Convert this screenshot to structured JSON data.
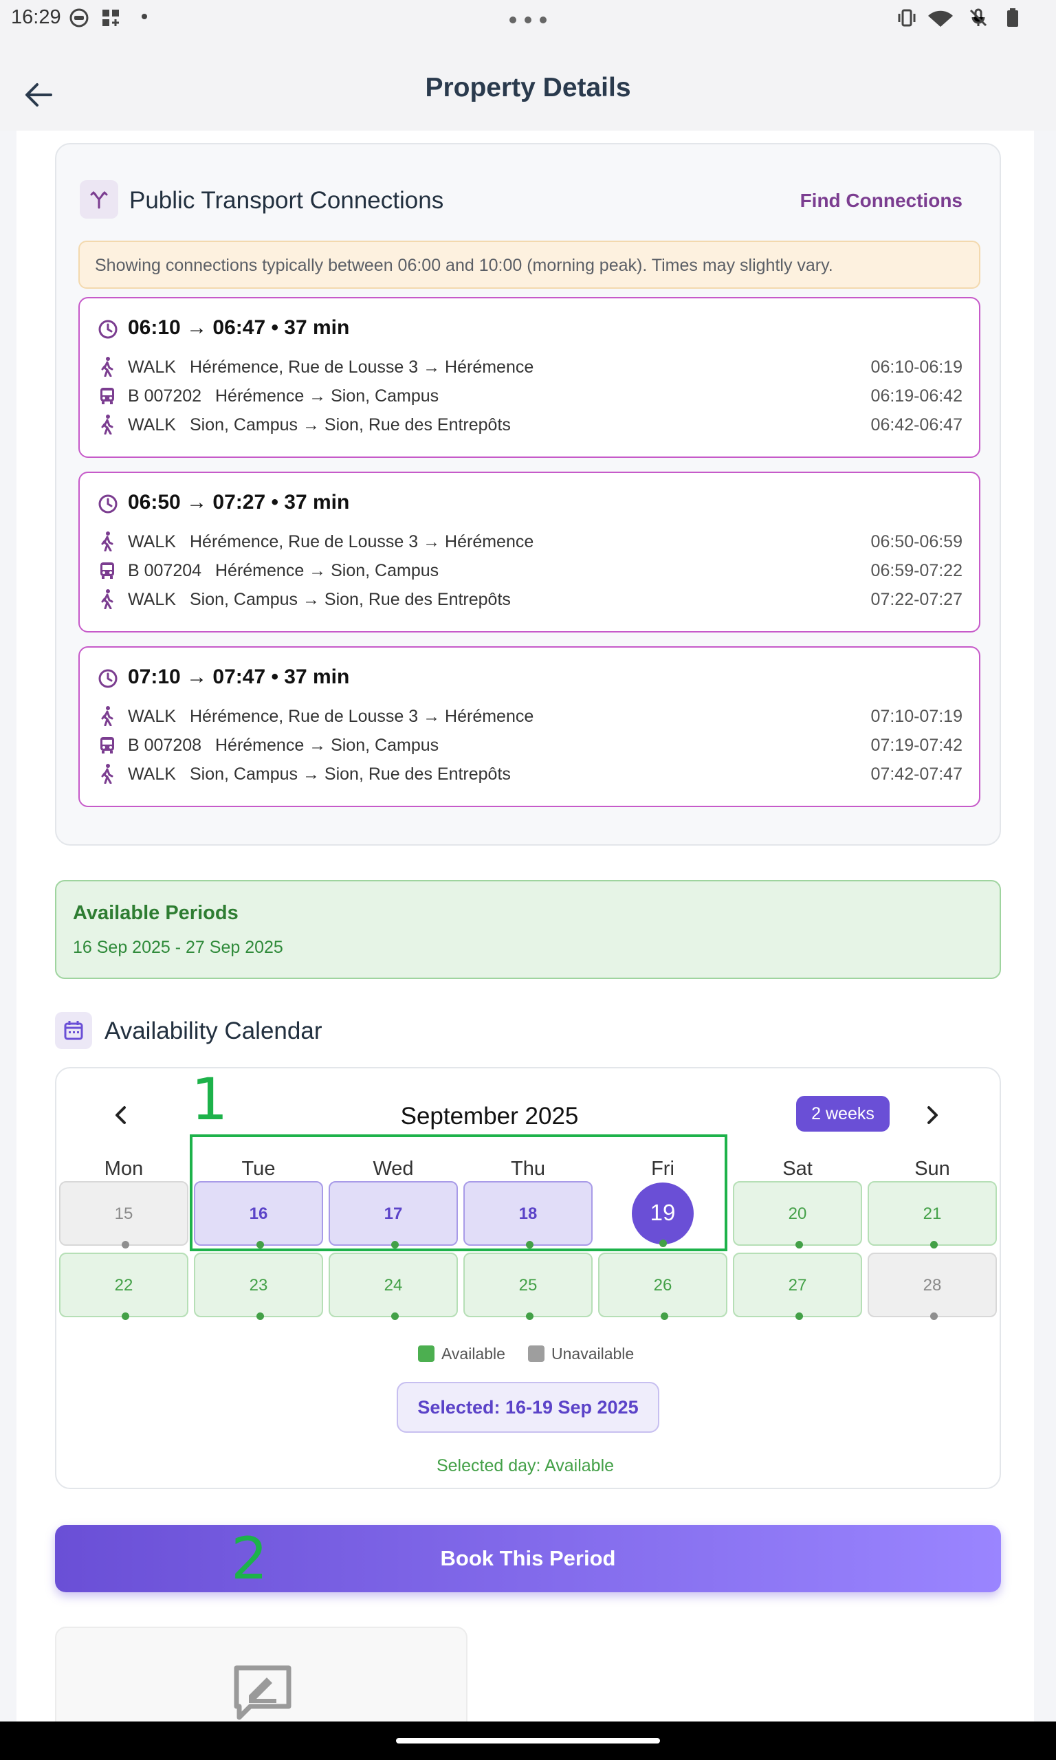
{
  "status_bar": {
    "time": "16:29"
  },
  "header": {
    "title": "Property Details"
  },
  "transport": {
    "title": "Public Transport Connections",
    "find_label": "Find Connections",
    "note": "Showing connections typically between 06:00 and 10:00 (morning peak). Times may slightly vary.",
    "connections": [
      {
        "summary": "06:10 → 06:47 • 37 min",
        "legs": [
          {
            "mode": "WALK",
            "route": "Hérémence, Rue de Lousse 3 → Hérémence",
            "time": "06:10-06:19",
            "icon": "walk-icon"
          },
          {
            "mode": "B 007202",
            "route": "Hérémence → Sion, Campus",
            "time": "06:19-06:42",
            "icon": "bus-icon"
          },
          {
            "mode": "WALK",
            "route": "Sion, Campus → Sion, Rue des Entrepôts",
            "time": "06:42-06:47",
            "icon": "walk-icon"
          }
        ]
      },
      {
        "summary": "06:50 → 07:27 • 37 min",
        "legs": [
          {
            "mode": "WALK",
            "route": "Hérémence, Rue de Lousse 3 → Hérémence",
            "time": "06:50-06:59",
            "icon": "walk-icon"
          },
          {
            "mode": "B 007204",
            "route": "Hérémence → Sion, Campus",
            "time": "06:59-07:22",
            "icon": "bus-icon"
          },
          {
            "mode": "WALK",
            "route": "Sion, Campus → Sion, Rue des Entrepôts",
            "time": "07:22-07:27",
            "icon": "walk-icon"
          }
        ]
      },
      {
        "summary": "07:10 → 07:47 • 37 min",
        "legs": [
          {
            "mode": "WALK",
            "route": "Hérémence, Rue de Lousse 3 → Hérémence",
            "time": "07:10-07:19",
            "icon": "walk-icon"
          },
          {
            "mode": "B 007208",
            "route": "Hérémence → Sion, Campus",
            "time": "07:19-07:42",
            "icon": "bus-icon"
          },
          {
            "mode": "WALK",
            "route": "Sion, Campus → Sion, Rue des Entrepôts",
            "time": "07:42-07:47",
            "icon": "walk-icon"
          }
        ]
      }
    ]
  },
  "available_periods": {
    "title": "Available Periods",
    "range": "16 Sep 2025 - 27 Sep 2025"
  },
  "calendar": {
    "title": "Availability Calendar",
    "month": "September 2025",
    "view_badge": "2 weeks",
    "weekdays": [
      "Mon",
      "Tue",
      "Wed",
      "Thu",
      "Fri",
      "Sat",
      "Sun"
    ],
    "weeks": [
      [
        {
          "day": "15",
          "state": "unavailable"
        },
        {
          "day": "16",
          "state": "selected"
        },
        {
          "day": "17",
          "state": "selected"
        },
        {
          "day": "18",
          "state": "selected"
        },
        {
          "day": "19",
          "state": "today"
        },
        {
          "day": "20",
          "state": "available"
        },
        {
          "day": "21",
          "state": "available"
        }
      ],
      [
        {
          "day": "22",
          "state": "available"
        },
        {
          "day": "23",
          "state": "available"
        },
        {
          "day": "24",
          "state": "available"
        },
        {
          "day": "25",
          "state": "available"
        },
        {
          "day": "26",
          "state": "available"
        },
        {
          "day": "27",
          "state": "available"
        },
        {
          "day": "28",
          "state": "unavailable"
        }
      ]
    ],
    "legend": {
      "available": "Available",
      "unavailable": "Unavailable"
    },
    "selected_label": "Selected: 16-19 Sep 2025",
    "selected_day_label": "Selected day: Available"
  },
  "book_button": {
    "label": "Book This Period"
  },
  "annotations": [
    "1",
    "2"
  ],
  "colors": {
    "accent": "#6a4fd6",
    "available": "#43a047",
    "unavailable": "#8f8f8f",
    "transport": "#7b3d90"
  }
}
